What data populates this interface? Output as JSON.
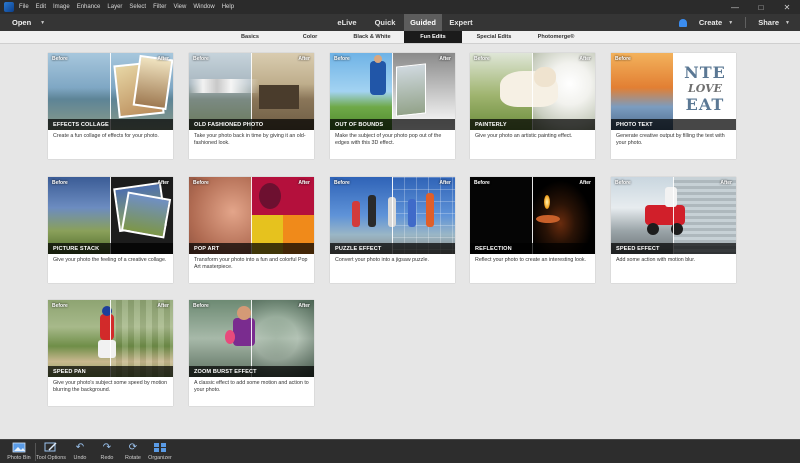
{
  "menubar": {
    "items": [
      "File",
      "Edit",
      "Image",
      "Enhance",
      "Layer",
      "Select",
      "Filter",
      "View",
      "Window",
      "Help"
    ]
  },
  "window_controls": {
    "minimize": "—",
    "maximize": "□",
    "close": "✕"
  },
  "modebar": {
    "open_label": "Open",
    "tabs": [
      "eLive",
      "Quick",
      "Guided",
      "Expert"
    ],
    "active_tab": "Guided",
    "create_label": "Create",
    "share_label": "Share"
  },
  "subtabs": {
    "items": [
      "Basics",
      "Color",
      "Black & White",
      "Fun Edits",
      "Special Edits",
      "Photomerge®"
    ],
    "active": "Fun Edits"
  },
  "thumb_labels": {
    "before": "Before",
    "after": "After"
  },
  "cards": [
    {
      "title": "EFFECTS COLLAGE",
      "desc": "Create a fun collage of effects for your photo.",
      "icon": "effects-collage-thumb"
    },
    {
      "title": "OLD FASHIONED PHOTO",
      "desc": "Take your photo back in time by giving it an old-fashioned look.",
      "icon": "old-fashioned-thumb"
    },
    {
      "title": "OUT OF BOUNDS",
      "desc": "Make the subject of your photo pop out of the edges with this 3D effect.",
      "icon": "out-of-bounds-thumb"
    },
    {
      "title": "PAINTERLY",
      "desc": "Give your photo an artistic painting effect.",
      "icon": "painterly-thumb"
    },
    {
      "title": "PHOTO TEXT",
      "desc": "Generate creative output by filling the text with your photo.",
      "icon": "photo-text-thumb"
    },
    {
      "title": "PICTURE STACK",
      "desc": "Give your photo the feeling of a creative collage.",
      "icon": "picture-stack-thumb"
    },
    {
      "title": "POP ART",
      "desc": "Transform your photo into a fun and colorful Pop Art masterpiece.",
      "icon": "pop-art-thumb"
    },
    {
      "title": "PUZZLE EFFECT",
      "desc": "Convert your photo into a jigsaw puzzle.",
      "icon": "puzzle-effect-thumb"
    },
    {
      "title": "REFLECTION",
      "desc": "Reflect your photo to create an interesting look.",
      "icon": "reflection-thumb"
    },
    {
      "title": "SPEED EFFECT",
      "desc": "Add some action with motion blur.",
      "icon": "speed-effect-thumb"
    },
    {
      "title": "SPEED PAN",
      "desc": "Give your photo's subject some speed by motion blurring the background.",
      "icon": "speed-pan-thumb"
    },
    {
      "title": "ZOOM BURST EFFECT",
      "desc": "A classic effect to add some motion and action to your photo.",
      "icon": "zoom-burst-thumb"
    }
  ],
  "bottombar": {
    "items": [
      {
        "label": "Photo Bin",
        "icon": "photo-bin-icon"
      },
      {
        "label": "Tool Options",
        "icon": "tool-options-icon"
      },
      {
        "label": "Undo",
        "icon": "undo-icon"
      },
      {
        "label": "Redo",
        "icon": "redo-icon"
      },
      {
        "label": "Rotate",
        "icon": "rotate-icon"
      },
      {
        "label": "Organizer",
        "icon": "organizer-icon"
      }
    ]
  },
  "photo_text_thumb": {
    "letters_top": "NTE",
    "letters_mid": "LOVE",
    "letters_bot": "EAT"
  }
}
